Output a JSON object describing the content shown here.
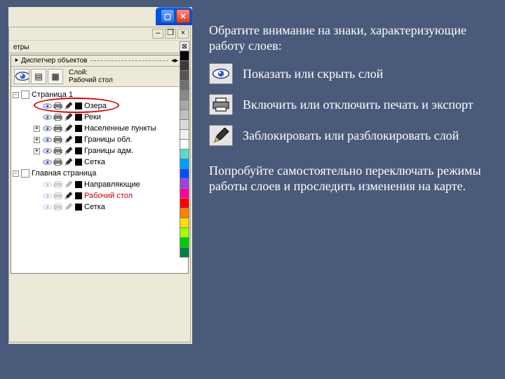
{
  "docker": {
    "tab_cut": "етры",
    "title_prefix": "⯈",
    "title": "Диспетчер объектов",
    "info_line1": "Слой:",
    "info_line2": "Рабочий стол"
  },
  "tree": {
    "page1": "Страница 1",
    "layers1": [
      {
        "name": "Озера",
        "color": "#000000",
        "eye": true,
        "print": true,
        "pen": true
      },
      {
        "name": "Реки",
        "color": "#000000",
        "eye": true,
        "print": true,
        "pen": true
      },
      {
        "name": "Населенные пункты",
        "color": "#000000",
        "eye": true,
        "print": true,
        "pen": true
      },
      {
        "name": "Границы обл.",
        "color": "#000000",
        "eye": true,
        "print": true,
        "pen": true
      },
      {
        "name": "Границы адм.",
        "color": "#000000",
        "eye": true,
        "print": true,
        "pen": true
      },
      {
        "name": "Сетка",
        "color": "#000000",
        "eye": true,
        "print": true,
        "pen": true
      }
    ],
    "master": "Главная страница",
    "layers2": [
      {
        "name": "Направляющие",
        "color": "#000000",
        "eye": false,
        "print": false,
        "pen": false,
        "dim": true
      },
      {
        "name": "Рабочий стол",
        "color": "#000000",
        "eye": false,
        "print": false,
        "pen": true,
        "red": true,
        "dim": true
      },
      {
        "name": "Сетка",
        "color": "#000000",
        "eye": false,
        "print": false,
        "pen": false,
        "dim": true
      }
    ]
  },
  "palette": [
    "#000000",
    "#3a3a3a",
    "#555555",
    "#707070",
    "#8a8a8a",
    "#a5a5a5",
    "#bfbfbf",
    "#dadada",
    "#f0f0f0",
    "#ffffff",
    "#5bd8c8",
    "#00a0ff",
    "#0050ff",
    "#a040e0",
    "#ff00a0",
    "#ff0000",
    "#ff8000",
    "#ffe000",
    "#a0ff00",
    "#00d000",
    "#008040"
  ],
  "explain": {
    "intro": "Обратите внимание на знаки, характеризующие работу слоев:",
    "eye": "Показать или скрыть слой",
    "print": "Включить или отключить печать и экспорт",
    "pen": "Заблокировать или разблокировать слой",
    "outro": "Попробуйте самостоятельно переключать режимы работы слоев и проследить изменения на карте."
  }
}
